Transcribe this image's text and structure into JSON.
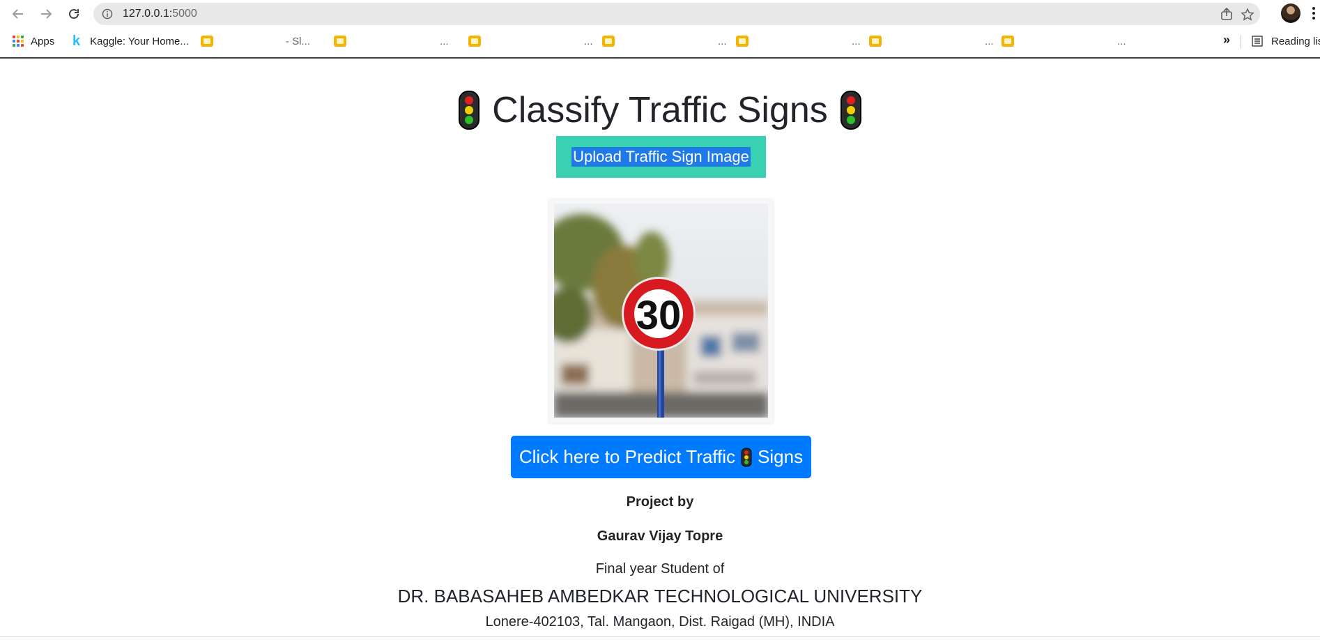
{
  "browser": {
    "url_host": "127.0.0.1:",
    "url_port": "5000",
    "bookmarks": {
      "apps_label": "Apps",
      "kaggle_label": "Kaggle: Your Home...",
      "folder_1": "- Sl...",
      "folder_2": "...",
      "folder_3": "...",
      "folder_4": "...",
      "folder_5": "...",
      "folder_6": "...",
      "folder_7": "...",
      "overflow": "»",
      "reading_list": "Reading list"
    }
  },
  "page": {
    "title": "Classify Traffic Signs",
    "upload_label": "Upload Traffic Sign Image",
    "preview_sign_value": "30",
    "predict_label_before": "Click here to Predict Traffic",
    "predict_label_after": "Signs",
    "project_by": "Project by",
    "author": "Gaurav Vijay Topre",
    "student_of": "Final year Student of",
    "university": "DR. BABASAHEB AMBEDKAR TECHNOLOGICAL UNIVERSITY",
    "address": "Lonere-402103, Tal. Mangaon, Dist. Raigad (MH), INDIA"
  },
  "colors": {
    "upload_button_bg": "#3ad0b2",
    "upload_text_highlight": "#1f7ae8",
    "predict_button_bg": "#007bff",
    "sign_ring": "#d71920",
    "bookmark_folder": "#f4b400"
  },
  "icons": {
    "back": "back-arrow-icon",
    "forward": "forward-arrow-icon",
    "reload": "reload-icon",
    "info": "info-icon",
    "share": "share-icon",
    "bookmark_star": "star-icon",
    "traffic_light": "traffic-light-icon"
  }
}
